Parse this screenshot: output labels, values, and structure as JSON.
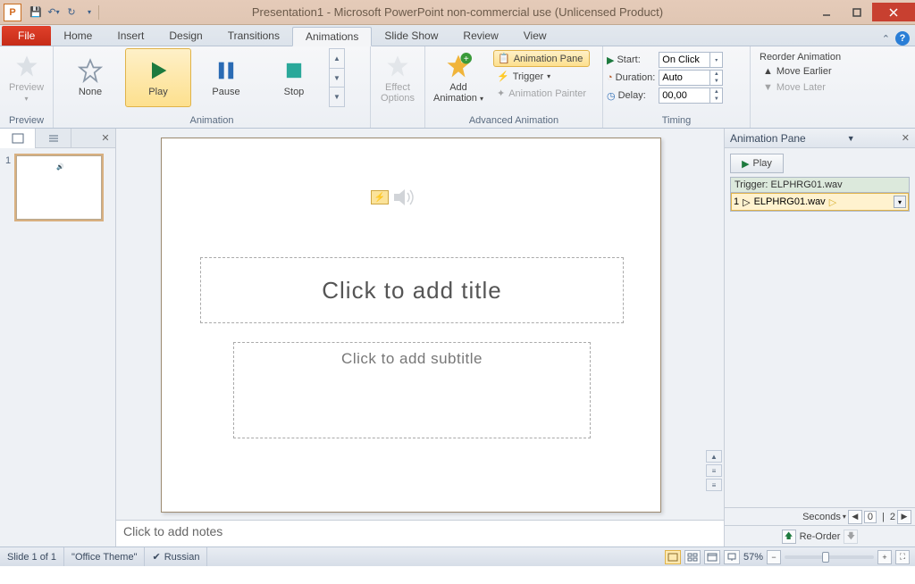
{
  "window": {
    "title": "Presentation1 - Microsoft PowerPoint non-commercial use (Unlicensed Product)"
  },
  "tabs": {
    "file": "File",
    "items": [
      "Home",
      "Insert",
      "Design",
      "Transitions",
      "Animations",
      "Slide Show",
      "Review",
      "View"
    ],
    "active": "Animations"
  },
  "ribbon": {
    "preview_group": {
      "preview_label": "Preview",
      "group_label": "Preview"
    },
    "animation_group": {
      "none": "None",
      "play": "Play",
      "pause": "Pause",
      "stop": "Stop",
      "group_label": "Animation"
    },
    "effect_options": "Effect\nOptions",
    "advanced": {
      "add_animation": "Add\nAnimation",
      "animation_pane": "Animation Pane",
      "trigger": "Trigger",
      "animation_painter": "Animation Painter",
      "group_label": "Advanced Animation"
    },
    "timing": {
      "start_label": "Start:",
      "start_value": "On Click",
      "duration_label": "Duration:",
      "duration_value": "Auto",
      "delay_label": "Delay:",
      "delay_value": "00,00",
      "group_label": "Timing"
    },
    "reorder": {
      "title": "Reorder Animation",
      "earlier": "Move Earlier",
      "later": "Move Later"
    }
  },
  "thumb": {
    "slide_num": "1"
  },
  "slide": {
    "title_placeholder": "Click to add title",
    "subtitle_placeholder": "Click to add subtitle"
  },
  "notes": {
    "placeholder": "Click to add notes"
  },
  "animation_pane": {
    "title": "Animation Pane",
    "play_label": "Play",
    "trigger_header": "Trigger: ELPHRG01.wav",
    "item_index": "1",
    "item_name": "ELPHRG01.wav",
    "seconds_label": "Seconds",
    "timeline_pos": "0",
    "timeline_end": "2",
    "reorder_label": "Re-Order"
  },
  "status": {
    "slide_info": "Slide 1 of 1",
    "theme": "\"Office Theme\"",
    "language": "Russian",
    "zoom": "57%"
  }
}
